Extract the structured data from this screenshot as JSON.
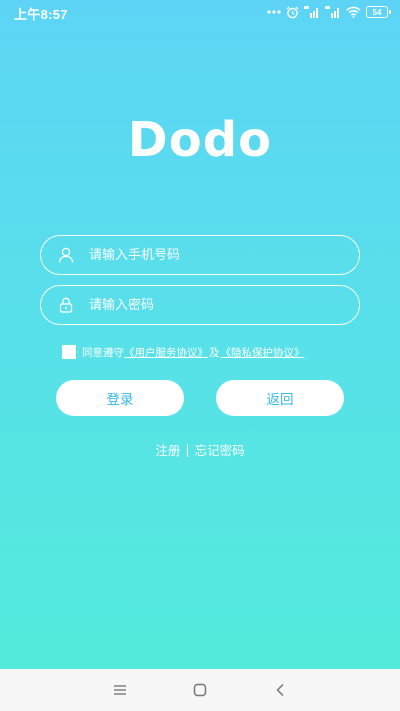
{
  "status_bar": {
    "time": "上午8:57",
    "battery": "54"
  },
  "app": {
    "logo_text": "Dodo"
  },
  "form": {
    "phone_placeholder": "请输入手机号码",
    "password_placeholder": "请输入密码"
  },
  "agreement": {
    "prefix": "同意遵守",
    "user_agreement": "《用户服务协议》",
    "conjunction": "及",
    "privacy_agreement": "《隐私保护协议》"
  },
  "buttons": {
    "login": "登录",
    "back": "返回"
  },
  "links": {
    "register": "注册",
    "separator": "|",
    "forgot_password": "忘记密码"
  },
  "icons": {
    "user": "user-icon",
    "lock": "lock-icon",
    "menu": "menu-icon",
    "home": "home-icon",
    "back": "back-icon"
  }
}
